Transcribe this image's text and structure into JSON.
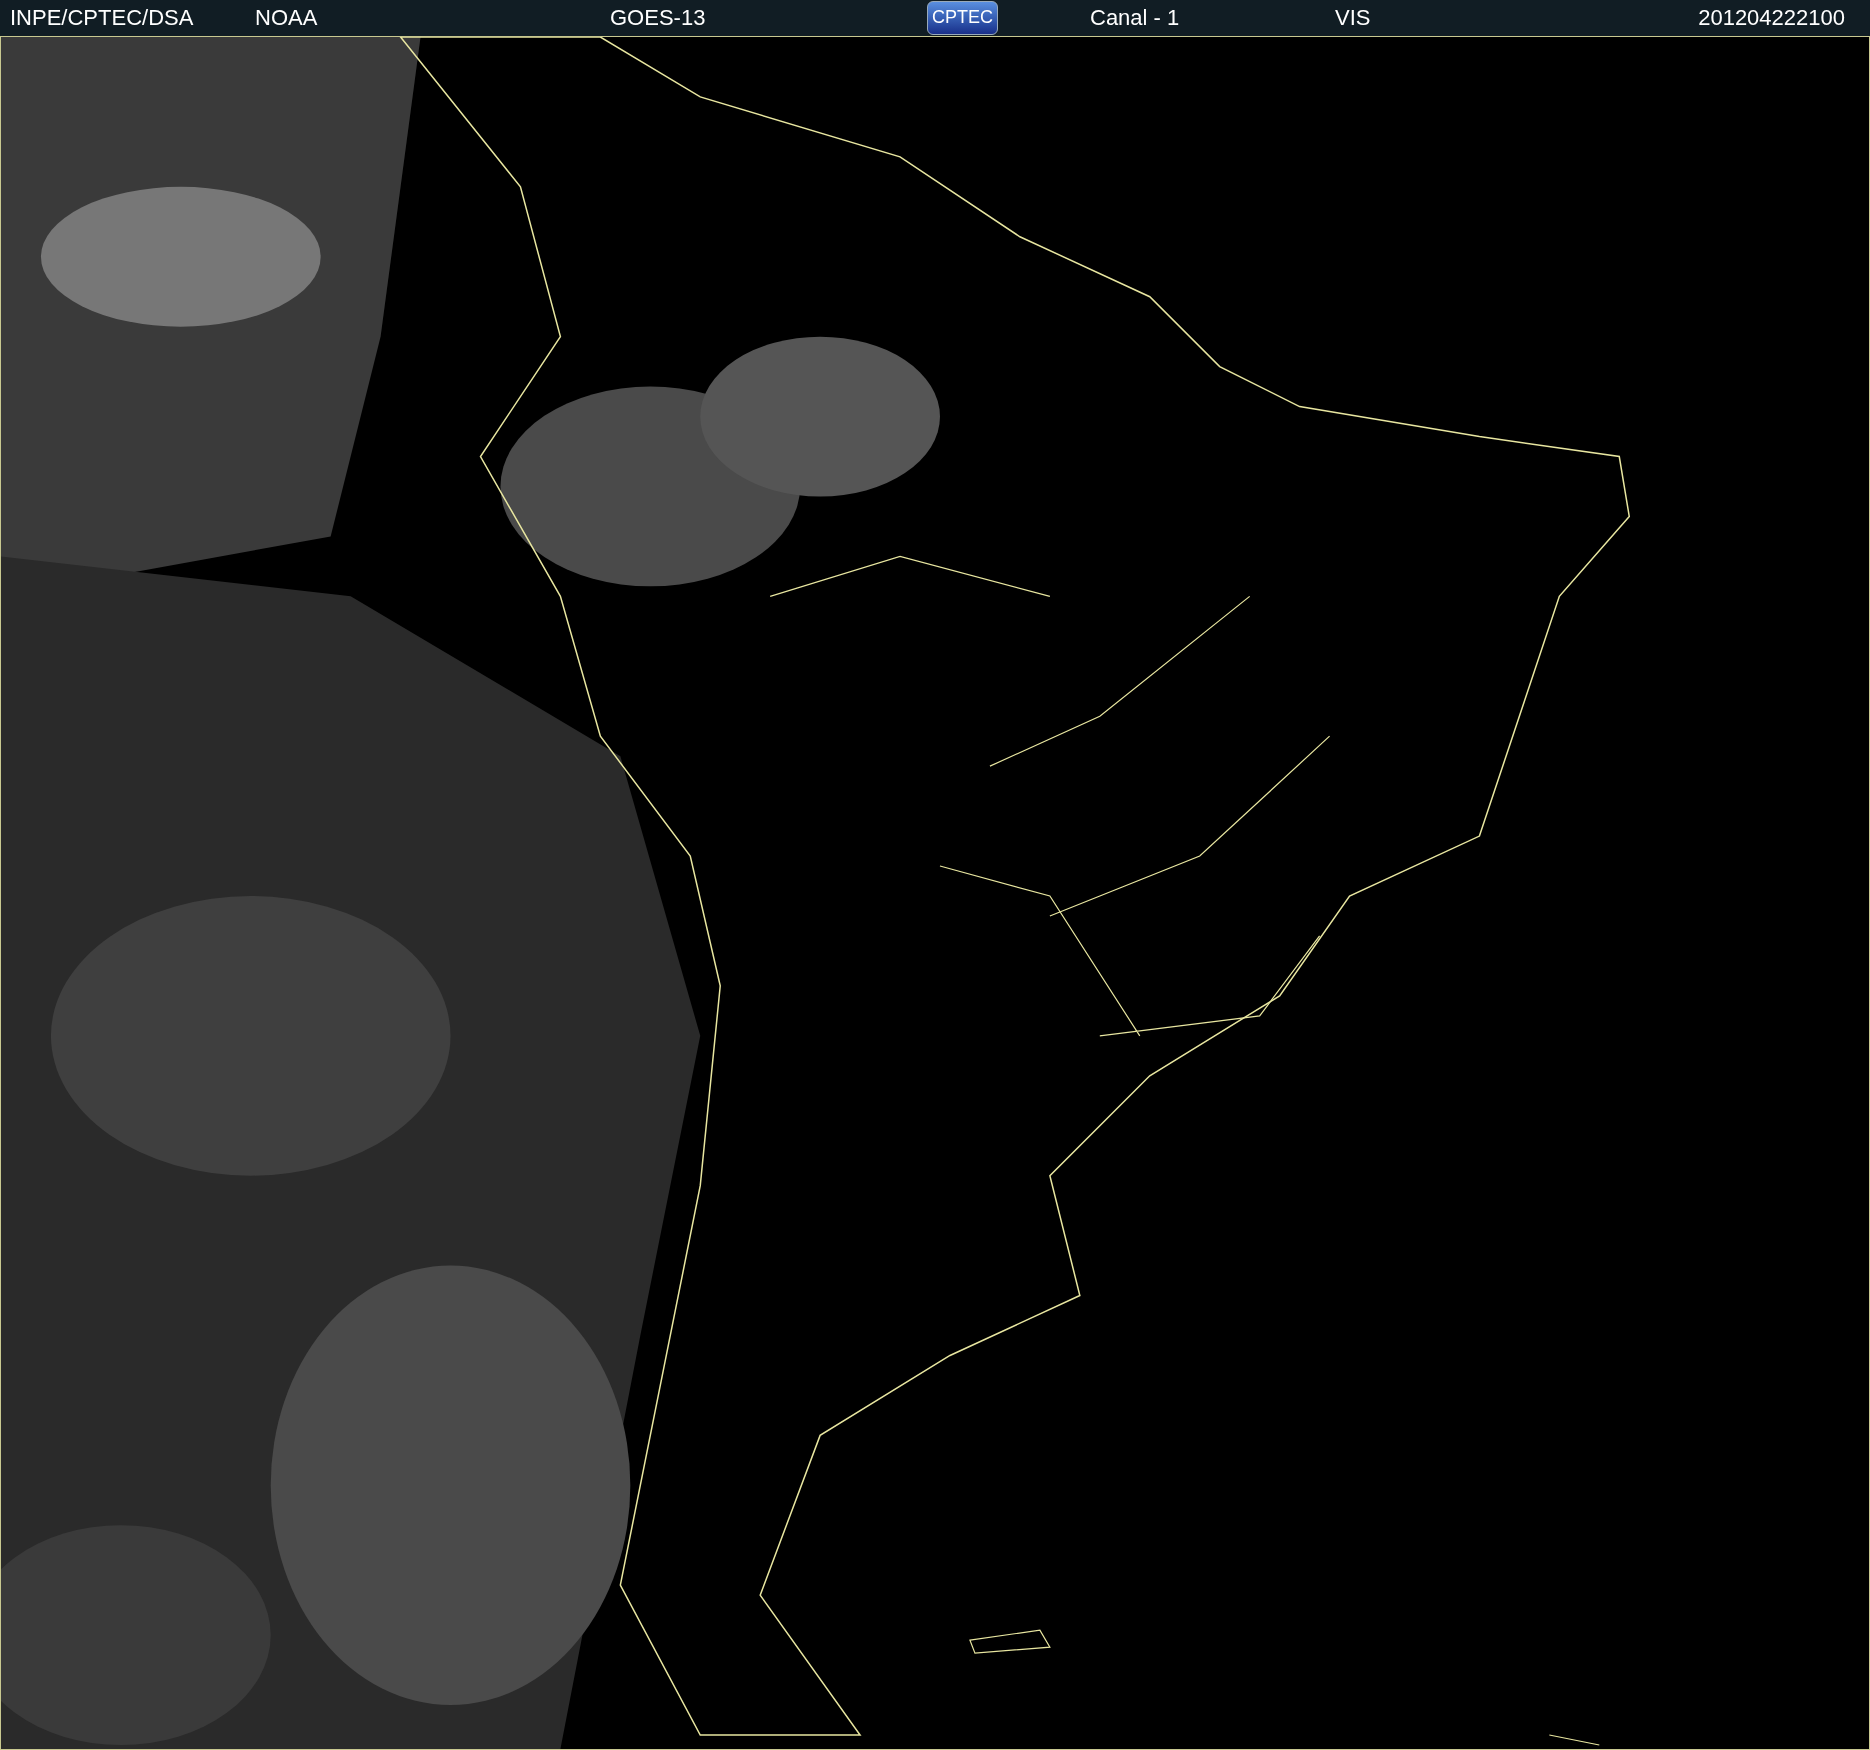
{
  "header": {
    "items": [
      {
        "kind": "text",
        "text": "INPE/CPTEC/DSA"
      },
      {
        "kind": "text",
        "text": "NOAA"
      },
      {
        "kind": "text",
        "text": "GOES-13"
      },
      {
        "kind": "logo",
        "text": "CPTEC"
      },
      {
        "kind": "text",
        "text": "Canal - 1"
      },
      {
        "kind": "text",
        "text": "VIS"
      },
      {
        "kind": "text",
        "text": "201204222100"
      }
    ]
  }
}
